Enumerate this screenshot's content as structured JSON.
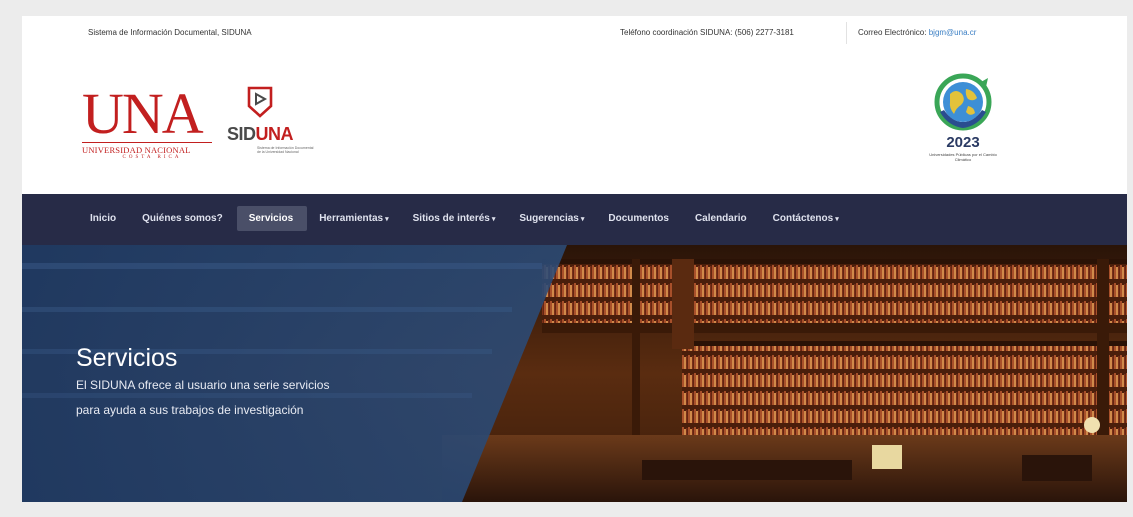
{
  "topbar": {
    "site_name": "Sistema de Información Documental, SIDUNA",
    "phone": "Teléfono coordinación SIDUNA: (506) 2277-3181",
    "email_label": "Correo Electrónico:",
    "email": "bjgm@una.cr"
  },
  "logos": {
    "una_big": "UNA",
    "una_sub": "UNIVERSIDAD NACIONAL",
    "una_country": "COSTA RICA",
    "siduna_a": "SID",
    "siduna_b": "UNA",
    "siduna_tagline": "Sistema de Información Documental de la Universidad Nacional",
    "badge_year": "2023",
    "badge_caption": "Universidades Públicas por el Cambio Climático"
  },
  "nav": {
    "items": [
      {
        "label": "Inicio",
        "caret": ""
      },
      {
        "label": "Quiénes somos?",
        "caret": ""
      },
      {
        "label": "Servicios",
        "caret": ""
      },
      {
        "label": "Herramientas",
        "caret": "▾"
      },
      {
        "label": "Sitios de interés",
        "caret": "▾"
      },
      {
        "label": "Sugerencias",
        "caret": "▾"
      },
      {
        "label": "Documentos",
        "caret": ""
      },
      {
        "label": "Calendario",
        "caret": ""
      },
      {
        "label": "Contáctenos",
        "caret": "▾"
      }
    ],
    "active_index": 2
  },
  "hero": {
    "title": "Servicios",
    "line1": "El SIDUNA ofrece al usuario una serie servicios",
    "line2": "para ayuda a sus trabajos de investigación"
  },
  "colors": {
    "nav_bg": "#272b47",
    "una_red": "#c21f1f",
    "overlay_blue": "#1f3d66"
  }
}
